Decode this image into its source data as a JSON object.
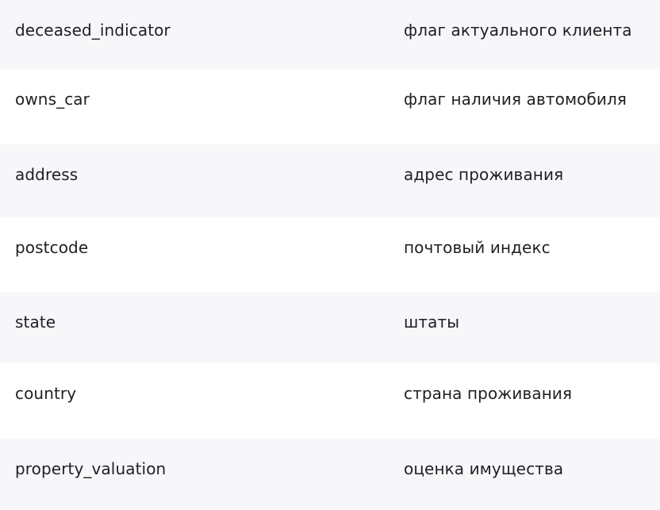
{
  "rows": [
    {
      "name": "deceased_indicator",
      "description": "флаг актуального клиента"
    },
    {
      "name": "owns_car",
      "description": "флаг наличия автомобиля"
    },
    {
      "name": "address",
      "description": "адрес проживания"
    },
    {
      "name": "postcode",
      "description": "почтовый индекс"
    },
    {
      "name": "state",
      "description": "штаты"
    },
    {
      "name": "country",
      "description": "страна проживания"
    },
    {
      "name": "property_valuation",
      "description": "оценка имущества"
    }
  ]
}
